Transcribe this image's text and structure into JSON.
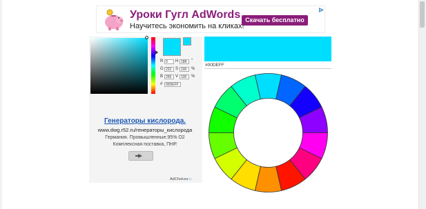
{
  "banner": {
    "title": "Уроки Гугл AdWords",
    "subtitle": "Научитесь экономить на кликах!",
    "button_label": "Скачать бесплатно",
    "accent_color": "#8a1e7a",
    "piggy_icon": "piggy-bank-icon",
    "adchoices_icon": "adchoices-icon"
  },
  "picker": {
    "current_color": "#00deff",
    "fields": [
      {
        "label": "R",
        "value": "0",
        "paired_label": "H",
        "paired_value": "188",
        "unit": "°"
      },
      {
        "label": "G",
        "value": "222",
        "paired_label": "S",
        "paired_value": "100",
        "unit": "%"
      },
      {
        "label": "B",
        "value": "255",
        "paired_label": "V",
        "paired_value": "100",
        "unit": "%"
      }
    ],
    "hex_label": "#",
    "hex_value": "00DEFF"
  },
  "left_ad": {
    "title": "Генераторы кислорода.",
    "url": "www.dwg.r52.ru/генераторы_кислорода",
    "desc1": "Германия. Промышленные.95% О2",
    "desc2": "Комплексная поставка, ПНР.",
    "arrow_icon": "arrow-right-icon",
    "adchoices": "AdChoices"
  },
  "result": {
    "hex_display": "#00DEFF"
  },
  "wheel": {
    "segments": [
      "#00deff",
      "#0066ff",
      "#1400ff",
      "#8e00ff",
      "#ff00f0",
      "#ff0080",
      "#ff1400",
      "#ff9000",
      "#ffde00",
      "#d4ff00",
      "#66ff00",
      "#12ff00",
      "#00ff6e",
      "#00ffcc"
    ]
  }
}
